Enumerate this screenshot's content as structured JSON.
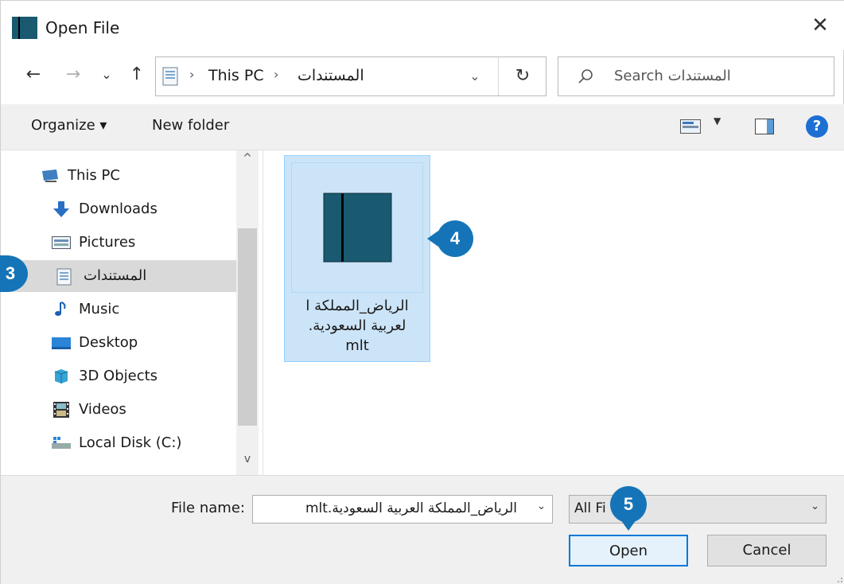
{
  "window": {
    "title": "Open File",
    "close_glyph": "✕",
    "icon": "document-icon"
  },
  "nav": {
    "back_glyph": "←",
    "forward_glyph": "→",
    "recent_glyph": "⌄",
    "up_glyph": "↑",
    "breadcrumb": [
      "This PC",
      "المستندات"
    ],
    "crumb_sep": "›",
    "dropdown_glyph": "⌄",
    "refresh_glyph": "↻"
  },
  "search": {
    "placeholder": "Search المستندات"
  },
  "toolbar": {
    "organize_label": "Organize ▾",
    "new_folder_label": "New folder",
    "view_dd_glyph": "▼",
    "help_glyph": "?"
  },
  "sidebar": {
    "items": [
      {
        "label": "This PC",
        "icon": "computer-icon"
      },
      {
        "label": "Downloads",
        "icon": "download-arrow-icon"
      },
      {
        "label": "Pictures",
        "icon": "pictures-icon"
      },
      {
        "label": "المستندات",
        "icon": "document-icon",
        "selected": true
      },
      {
        "label": "Music",
        "icon": "music-note-icon"
      },
      {
        "label": "Desktop",
        "icon": "desktop-icon"
      },
      {
        "label": "3D Objects",
        "icon": "cube-icon"
      },
      {
        "label": "Videos",
        "icon": "film-icon"
      },
      {
        "label": "Local Disk (C:)",
        "icon": "drive-icon"
      }
    ],
    "scroll_up_glyph": "^",
    "scroll_down_glyph": "v"
  },
  "files": [
    {
      "name": "الرياض_المملكة العربية السعودية.mlt",
      "name_line1": "الرياض_المملكة ا",
      "name_line2": "لعربية السعودية.",
      "name_line3": "mlt",
      "selected": true
    }
  ],
  "footer": {
    "file_name_label": "File name:",
    "file_name_value": "الرياض_المملكة العربية السعودية.mlt",
    "file_type_value": "All Fi",
    "dd_glyph": "⌄",
    "open_label": "Open",
    "cancel_label": "Cancel"
  },
  "markers": {
    "step3": "3",
    "step4": "4",
    "step5": "5"
  },
  "colors": {
    "accent": "#1574b8",
    "selection": "#cce4f7",
    "file_icon": "#1a5a70"
  }
}
